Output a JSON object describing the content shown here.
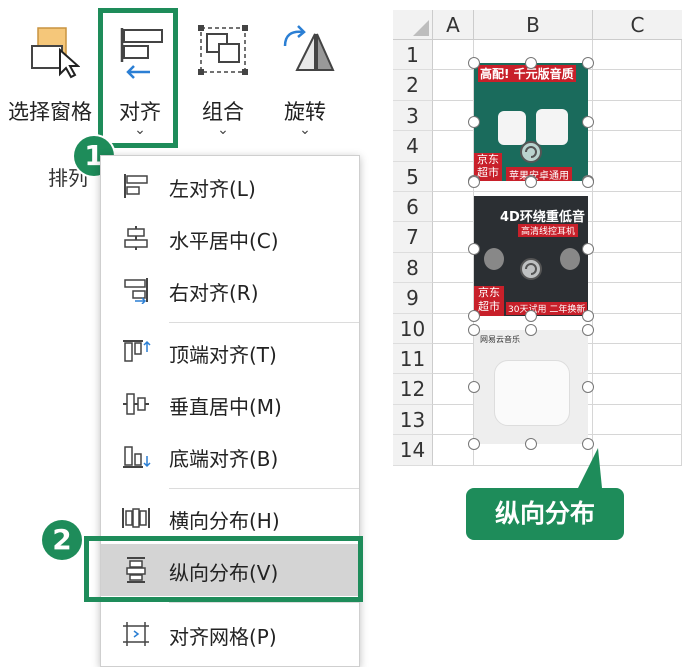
{
  "ribbon": {
    "selection_pane": "选择窗格",
    "align": "对齐",
    "group": "组合",
    "rotate": "旋转",
    "caret": "⌄",
    "arrange_group_label": "排列"
  },
  "steps": {
    "step1": "1",
    "step2": "2"
  },
  "menu": {
    "items": [
      {
        "label": "左对齐(L)",
        "icon": "align-left-icon"
      },
      {
        "label": "水平居中(C)",
        "icon": "align-center-icon"
      },
      {
        "label": "右对齐(R)",
        "icon": "align-right-icon"
      },
      {
        "label": "顶端对齐(T)",
        "icon": "align-top-icon"
      },
      {
        "label": "垂直居中(M)",
        "icon": "align-middle-icon"
      },
      {
        "label": "底端对齐(B)",
        "icon": "align-bottom-icon"
      },
      {
        "label": "横向分布(H)",
        "icon": "distribute-horizontal-icon"
      },
      {
        "label": "纵向分布(V)",
        "icon": "distribute-vertical-icon"
      },
      {
        "label": "对齐网格(P)",
        "icon": "snap-to-grid-icon"
      }
    ],
    "selected_index": 7
  },
  "sheet": {
    "columns": [
      "A",
      "B",
      "C"
    ],
    "rows": [
      "1",
      "2",
      "3",
      "4",
      "5",
      "6",
      "7",
      "8",
      "9",
      "10",
      "11",
      "12",
      "13",
      "14"
    ],
    "images": [
      {
        "headline": "高配! 千元版音质",
        "store_line1": "京东",
        "store_line2": "超市",
        "footer": "苹果安卓通用"
      },
      {
        "headline": "4D环绕重低音",
        "subline": "高清线控耳机",
        "store_line1": "京东",
        "store_line2": "超市",
        "footer": "30天试用 二年换新"
      },
      {
        "brand": "网易云音乐"
      }
    ]
  },
  "callout": "纵向分布",
  "colors": {
    "accent_green": "#1e8c5a",
    "highlight_border": "#1e8c5a",
    "menu_selected_bg": "#d4d4d4",
    "product_red": "#c8202a",
    "product_teal": "#1a6b5c"
  }
}
